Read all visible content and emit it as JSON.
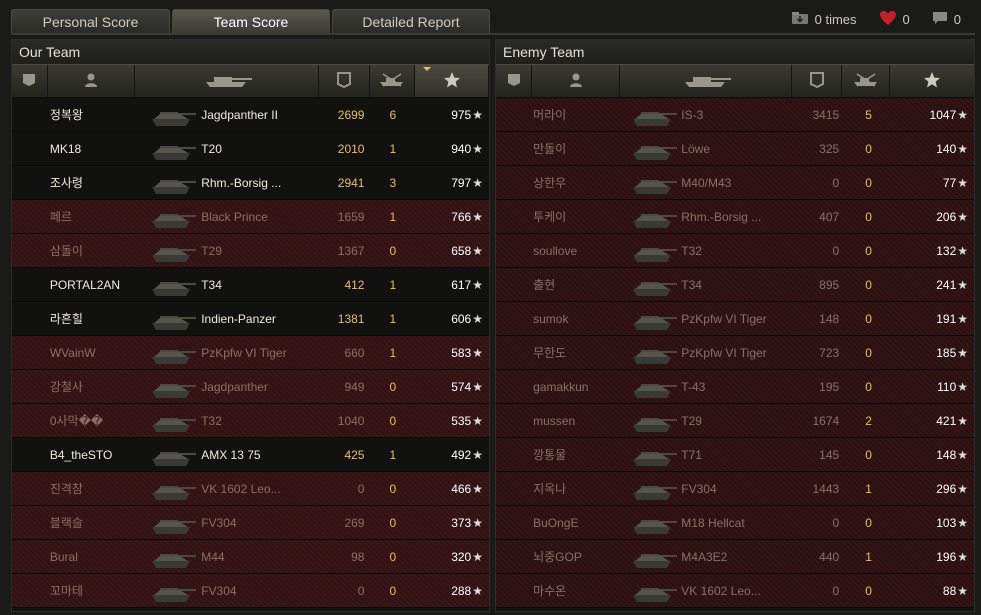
{
  "tabs": [
    "Personal Score",
    "Team Score",
    "Detailed Report"
  ],
  "active_tab": 1,
  "stats": {
    "times_label": "0 times",
    "likes": "0",
    "comments": "0"
  },
  "our_team": {
    "title": "Our Team",
    "rows": [
      {
        "name": "정복왕",
        "tank": "Jagdpanther II",
        "damage": "2699",
        "kills": "6",
        "xp": "975",
        "alive": true
      },
      {
        "name": "MK18",
        "tank": "T20",
        "damage": "2010",
        "kills": "1",
        "xp": "940",
        "alive": true
      },
      {
        "name": "조사령",
        "tank": "Rhm.-Borsig ...",
        "damage": "2941",
        "kills": "3",
        "xp": "797",
        "alive": true
      },
      {
        "name": "페르",
        "tank": "Black Prince",
        "damage": "1659",
        "kills": "1",
        "xp": "766",
        "alive": false
      },
      {
        "name": "삼돌이",
        "tank": "T29",
        "damage": "1367",
        "kills": "0",
        "xp": "658",
        "alive": false
      },
      {
        "name": "PORTAL2AN",
        "tank": "T34",
        "damage": "412",
        "kills": "1",
        "xp": "617",
        "alive": true
      },
      {
        "name": "라흔힐",
        "tank": "Indien-Panzer",
        "damage": "1381",
        "kills": "1",
        "xp": "606",
        "alive": true
      },
      {
        "name": "WVainW",
        "tank": "PzKpfw VI Tiger",
        "damage": "660",
        "kills": "1",
        "xp": "583",
        "alive": false
      },
      {
        "name": "강철사",
        "tank": "Jagdpanther",
        "damage": "949",
        "kills": "0",
        "xp": "574",
        "alive": false
      },
      {
        "name": "0사막��",
        "tank": "T32",
        "damage": "1040",
        "kills": "0",
        "xp": "535",
        "alive": false
      },
      {
        "name": "B4_theSTO",
        "tank": "AMX 13 75",
        "damage": "425",
        "kills": "1",
        "xp": "492",
        "alive": true
      },
      {
        "name": "진격참",
        "tank": "VK 1602 Leo...",
        "damage": "0",
        "kills": "0",
        "xp": "466",
        "alive": false
      },
      {
        "name": "블랙슬",
        "tank": "FV304",
        "damage": "269",
        "kills": "0",
        "xp": "373",
        "alive": false
      },
      {
        "name": "Bural",
        "tank": "M44",
        "damage": "98",
        "kills": "0",
        "xp": "320",
        "alive": false
      },
      {
        "name": "꼬마테",
        "tank": "FV304",
        "damage": "0",
        "kills": "0",
        "xp": "288",
        "alive": false
      }
    ]
  },
  "enemy_team": {
    "title": "Enemy Team",
    "rows": [
      {
        "name": "머라이",
        "tank": "IS-3",
        "damage": "3415",
        "kills": "5",
        "xp": "1047",
        "alive": false
      },
      {
        "name": "만돌이",
        "tank": "Löwe",
        "damage": "325",
        "kills": "0",
        "xp": "140",
        "alive": false
      },
      {
        "name": "상한우",
        "tank": "M40/M43",
        "damage": "0",
        "kills": "0",
        "xp": "77",
        "alive": false
      },
      {
        "name": "투케이",
        "tank": "Rhm.-Borsig ...",
        "damage": "407",
        "kills": "0",
        "xp": "206",
        "alive": false
      },
      {
        "name": "soullove",
        "tank": "T32",
        "damage": "0",
        "kills": "0",
        "xp": "132",
        "alive": false
      },
      {
        "name": "출현",
        "tank": "T34",
        "damage": "895",
        "kills": "0",
        "xp": "241",
        "alive": false
      },
      {
        "name": "sumok",
        "tank": "PzKpfw VI Tiger",
        "damage": "148",
        "kills": "0",
        "xp": "191",
        "alive": false
      },
      {
        "name": "무한도",
        "tank": "PzKpfw VI Tiger",
        "damage": "723",
        "kills": "0",
        "xp": "185",
        "alive": false
      },
      {
        "name": "gamakkun",
        "tank": "T-43",
        "damage": "195",
        "kills": "0",
        "xp": "110",
        "alive": false
      },
      {
        "name": "mussen",
        "tank": "T29",
        "damage": "1674",
        "kills": "2",
        "xp": "421",
        "alive": false
      },
      {
        "name": "깡통물",
        "tank": "T71",
        "damage": "145",
        "kills": "0",
        "xp": "148",
        "alive": false
      },
      {
        "name": "지옥나",
        "tank": "FV304",
        "damage": "1443",
        "kills": "1",
        "xp": "296",
        "alive": false
      },
      {
        "name": "BuOngE",
        "tank": "M18 Hellcat",
        "damage": "0",
        "kills": "0",
        "xp": "103",
        "alive": false
      },
      {
        "name": "뇌중GOP",
        "tank": "M4A3E2",
        "damage": "440",
        "kills": "1",
        "xp": "196",
        "alive": false
      },
      {
        "name": "마수온",
        "tank": "VK 1602 Leo...",
        "damage": "0",
        "kills": "0",
        "xp": "88",
        "alive": false
      }
    ]
  },
  "icons": {
    "column_flag": "flag-icon",
    "column_player": "player-icon",
    "column_tank": "tank-icon",
    "column_damage": "damage-icon",
    "column_kills": "kills-icon",
    "column_xp": "star-icon",
    "sorted_column": "xp"
  },
  "colors": {
    "accent": "#e8bf6a",
    "dead_row": "#3a1616",
    "alive_row": "#111110",
    "like": "#c8202a"
  }
}
